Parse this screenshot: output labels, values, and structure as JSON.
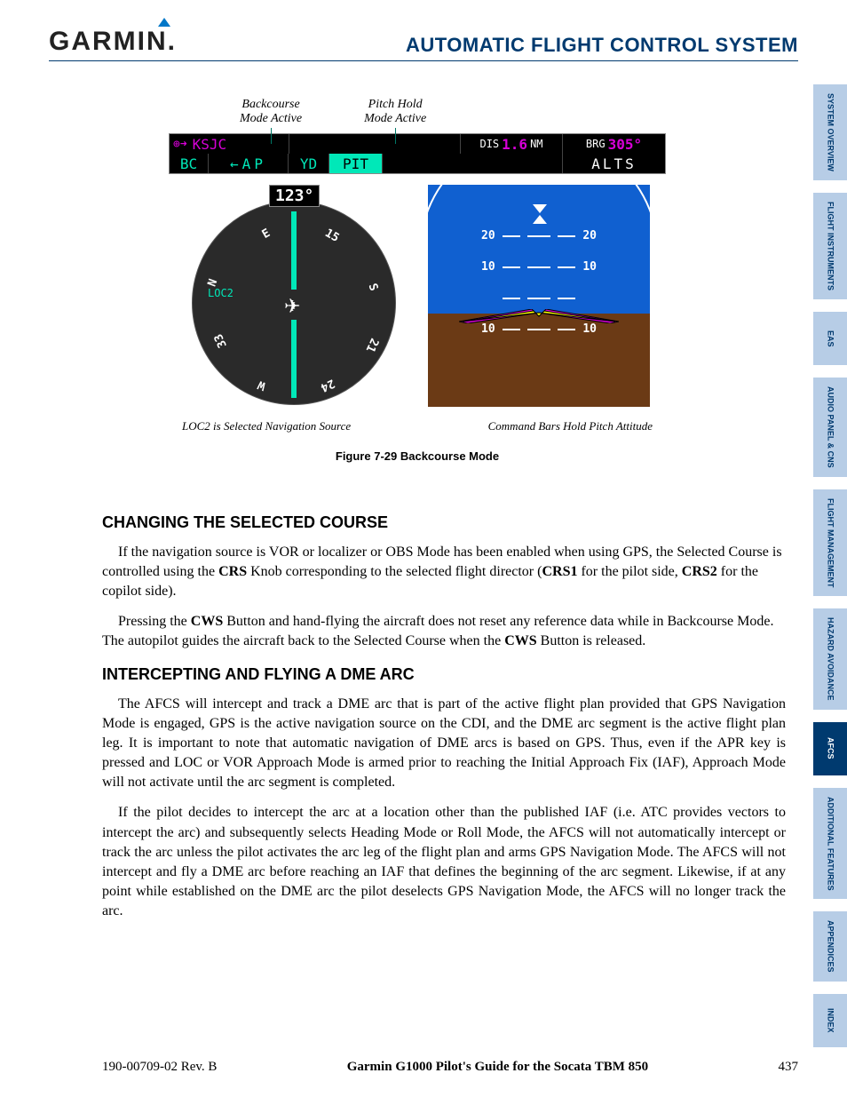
{
  "header": {
    "logo_text": "GARMIN",
    "section_title": "AUTOMATIC FLIGHT CONTROL SYSTEM"
  },
  "tabs": [
    "SYSTEM OVERVIEW",
    "FLIGHT INSTRUMENTS",
    "EAS",
    "AUDIO PANEL & CNS",
    "FLIGHT MANAGEMENT",
    "HAZARD AVOIDANCE",
    "AFCS",
    "ADDITIONAL FEATURES",
    "APPENDICES",
    "INDEX"
  ],
  "figure": {
    "callout_left_line1": "Backcourse",
    "callout_left_line2": "Mode Active",
    "callout_right_line1": "Pitch Hold",
    "callout_right_line2": "Mode Active",
    "bar": {
      "wpt_icon": "⊕➜",
      "wpt": "KSJC",
      "dis_label": "DIS",
      "dis_val": "1.6",
      "dis_unit": "NM",
      "brg_label": "BRG",
      "brg_val": "305°",
      "bc": "BC",
      "ap": "←AP",
      "yd": "YD",
      "pit": "PIT",
      "alts": "ALTS"
    },
    "hsi": {
      "heading": "123°",
      "navsrc": "LOC2"
    },
    "adi": {
      "p20": "20",
      "p10": "10"
    },
    "caption_left": "LOC2 is Selected Navigation Source",
    "caption_right": "Command Bars Hold Pitch Attitude",
    "title": "Figure 7-29  Backcourse Mode"
  },
  "body": {
    "h1": "CHANGING THE SELECTED COURSE",
    "p1a": "If the navigation source is VOR or localizer or OBS Mode has been enabled when using GPS, the Selected Course is controlled using the ",
    "p1b_bold": "CRS",
    "p1c": " Knob corresponding to the selected flight director (",
    "p1d_bold": "CRS1",
    "p1e": " for the pilot side, ",
    "p1f_bold": "CRS2",
    "p1g": " for the copilot side).",
    "p2a": "Pressing the ",
    "p2b_bold": "CWS",
    "p2c": " Button and hand-flying the aircraft does not reset any reference data while in Backcourse Mode.  The autopilot guides the aircraft back to the Selected Course when the ",
    "p2d_bold": "CWS",
    "p2e": " Button is released.",
    "h2": "INTERCEPTING AND FLYING A DME ARC",
    "p3": "The AFCS will intercept and track a DME arc that is part of the active flight plan provided that GPS Navigation Mode is engaged, GPS is the active navigation source on the CDI, and the DME arc segment is the active flight plan leg.  It is important to note that automatic navigation of DME arcs is based on GPS.  Thus, even if the APR key is pressed and LOC or VOR Approach Mode is armed prior to reaching the Initial Approach Fix (IAF), Approach Mode will not activate until the arc segment is completed.",
    "p4": "If the pilot decides to intercept the arc at a location other than the published IAF (i.e. ATC provides vectors to intercept the arc) and subsequently selects Heading Mode or Roll Mode, the AFCS will not automatically intercept or track the arc unless the pilot activates the arc leg of the flight plan and arms GPS Navigation Mode.  The AFCS will not intercept and fly a DME arc before reaching an IAF that defines the beginning of the arc segment.  Likewise, if at any point while established on the DME arc the pilot deselects GPS Navigation Mode, the AFCS will no longer track the arc."
  },
  "footer": {
    "left": "190-00709-02  Rev. B",
    "center": "Garmin G1000 Pilot's Guide for the Socata TBM 850",
    "right": "437"
  }
}
